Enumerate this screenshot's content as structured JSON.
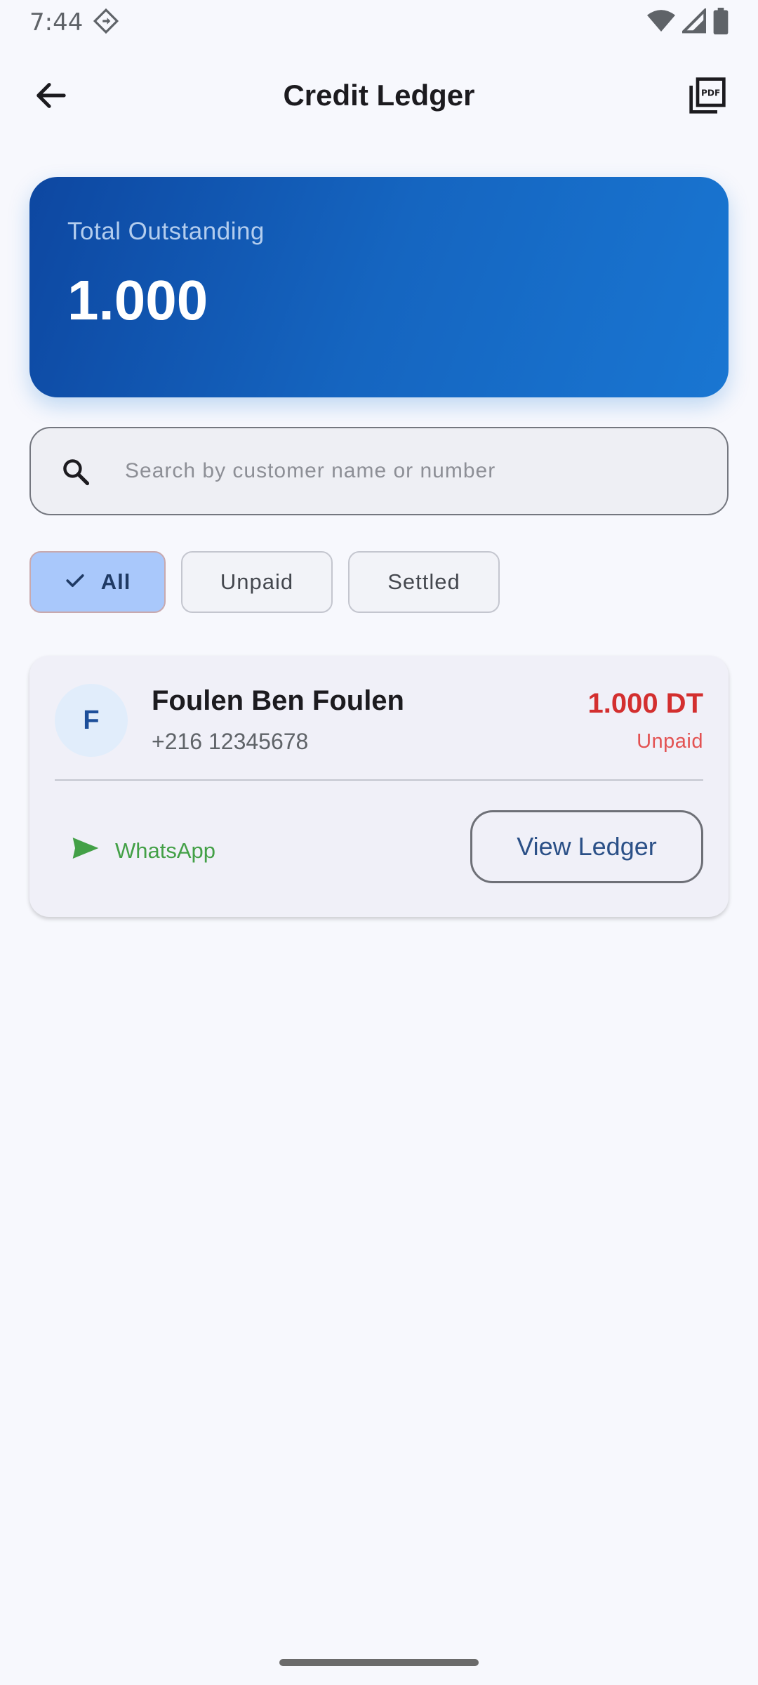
{
  "status_bar": {
    "time": "7:44",
    "notification_icon": "navigation-diamond-icon",
    "icons": [
      "wifi-icon",
      "cell-signal-icon",
      "battery-icon"
    ]
  },
  "app_bar": {
    "title": "Credit Ledger",
    "back_icon": "arrow-back-icon",
    "action_icon": "pdf-icon"
  },
  "summary": {
    "label": "Total Outstanding",
    "amount": "1.000"
  },
  "search": {
    "placeholder": "Search by customer name or number",
    "value": ""
  },
  "filters": {
    "selected": "All",
    "chips": [
      {
        "label": "All",
        "selected": true
      },
      {
        "label": "Unpaid",
        "selected": false
      },
      {
        "label": "Settled",
        "selected": false
      }
    ]
  },
  "customers": [
    {
      "initial": "F",
      "name": "Foulen Ben Foulen",
      "phone": "+216 12345678",
      "amount": "1.000 DT",
      "status": "Unpaid",
      "whatsapp_label": "WhatsApp",
      "view_label": "View Ledger"
    }
  ],
  "colors": {
    "accent": "#1565c0",
    "unpaid": "#d32f2f",
    "whatsapp": "#43a047",
    "chip_selected": "#a9c8fb"
  }
}
